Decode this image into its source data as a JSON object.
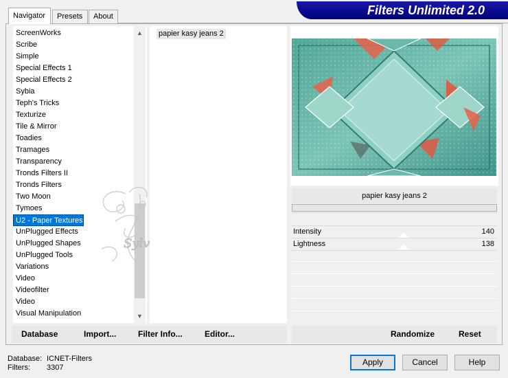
{
  "tabs": [
    {
      "label": "Navigator",
      "active": true
    },
    {
      "label": "Presets",
      "active": false
    },
    {
      "label": "About",
      "active": false
    }
  ],
  "title": "Filters Unlimited 2.0",
  "categories": [
    "ScreenWorks",
    "Scribe",
    "Simple",
    "Special Effects 1",
    "Special Effects 2",
    "Sybia",
    "Teph's Tricks",
    "Texturize",
    "Tile & Mirror",
    "Toadies",
    "Tramages",
    "Transparency",
    "Tronds Filters II",
    "Tronds Filters",
    "Two Moon",
    "Tymoes",
    "U2 - Paper Textures",
    "UnPlugged Effects",
    "UnPlugged Shapes",
    "UnPlugged Tools",
    "Variations",
    "Video",
    "Videofilter",
    "Video",
    "Visual Manipulation"
  ],
  "selected_category": "U2 - Paper Textures",
  "filters": [
    "papier kasy jeans 2"
  ],
  "preview": {
    "filter_name": "papier kasy jeans 2",
    "progress_percent": 0
  },
  "params": [
    {
      "label": "Intensity",
      "value": "140"
    },
    {
      "label": "Lightness",
      "value": "138"
    }
  ],
  "left_buttons": [
    "Database",
    "Import...",
    "Filter Info...",
    "Editor..."
  ],
  "right_buttons": [
    "Randomize",
    "Reset"
  ],
  "status": {
    "database_label": "Database:",
    "database_value": "ICNET-Filters",
    "filters_label": "Filters:",
    "filters_value": "3307"
  },
  "dialog_buttons": [
    "Apply",
    "Cancel",
    "Help"
  ],
  "watermark": "Sylviane",
  "colors": {
    "banner": "#1a1aa8",
    "selection": "#0078d7",
    "preview_teal": "#5fb3a6",
    "preview_accent": "#e8604a"
  }
}
